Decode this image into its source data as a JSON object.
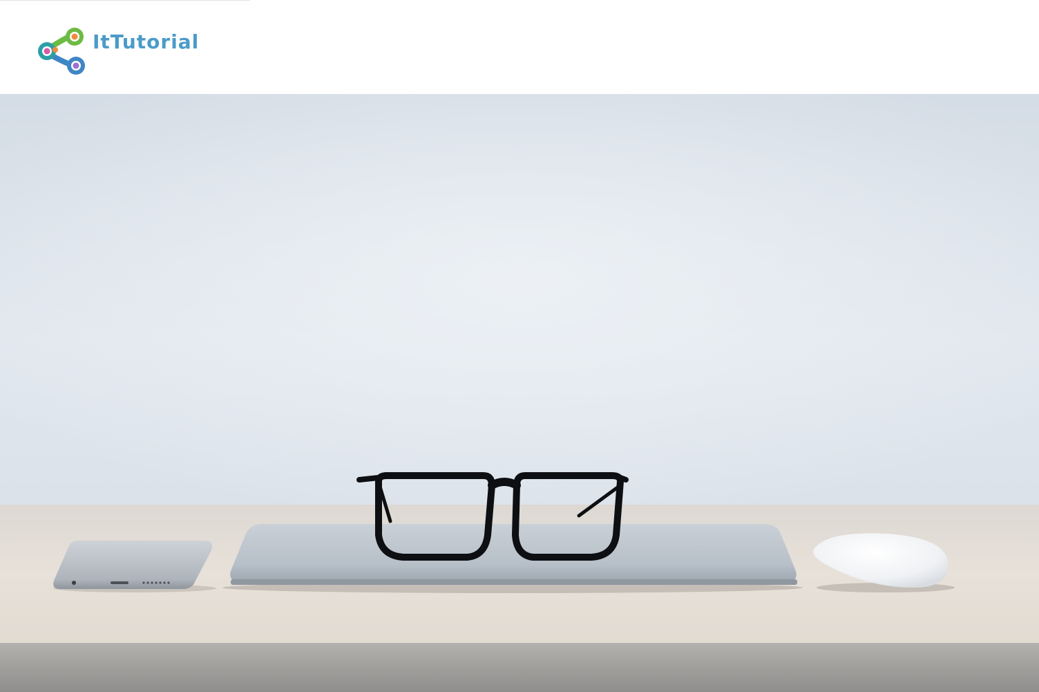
{
  "header": {
    "logo": {
      "text": "ItTutorial",
      "icon": "chain-link-logo-icon",
      "colors": {
        "text": "#4b9bc9",
        "link_green": "#6dbb45",
        "link_blue": "#3f86c5",
        "link_teal": "#2c9fa6",
        "dot_orange": "#f28a3c",
        "dot_pink": "#d85aa7",
        "dot_purple": "#9b6fd3"
      }
    }
  },
  "hero": {
    "image": "desk-with-glasses-laptop-phone-mouse",
    "colors": {
      "wall": "#dde4ec",
      "desk": "#e3ddd6",
      "desk_edge": "#9f9d9a",
      "laptop": "#bcc4cc",
      "phone": "#c0c6cd",
      "mouse": "#f3f4f6",
      "glasses": "#0d0f12"
    }
  }
}
